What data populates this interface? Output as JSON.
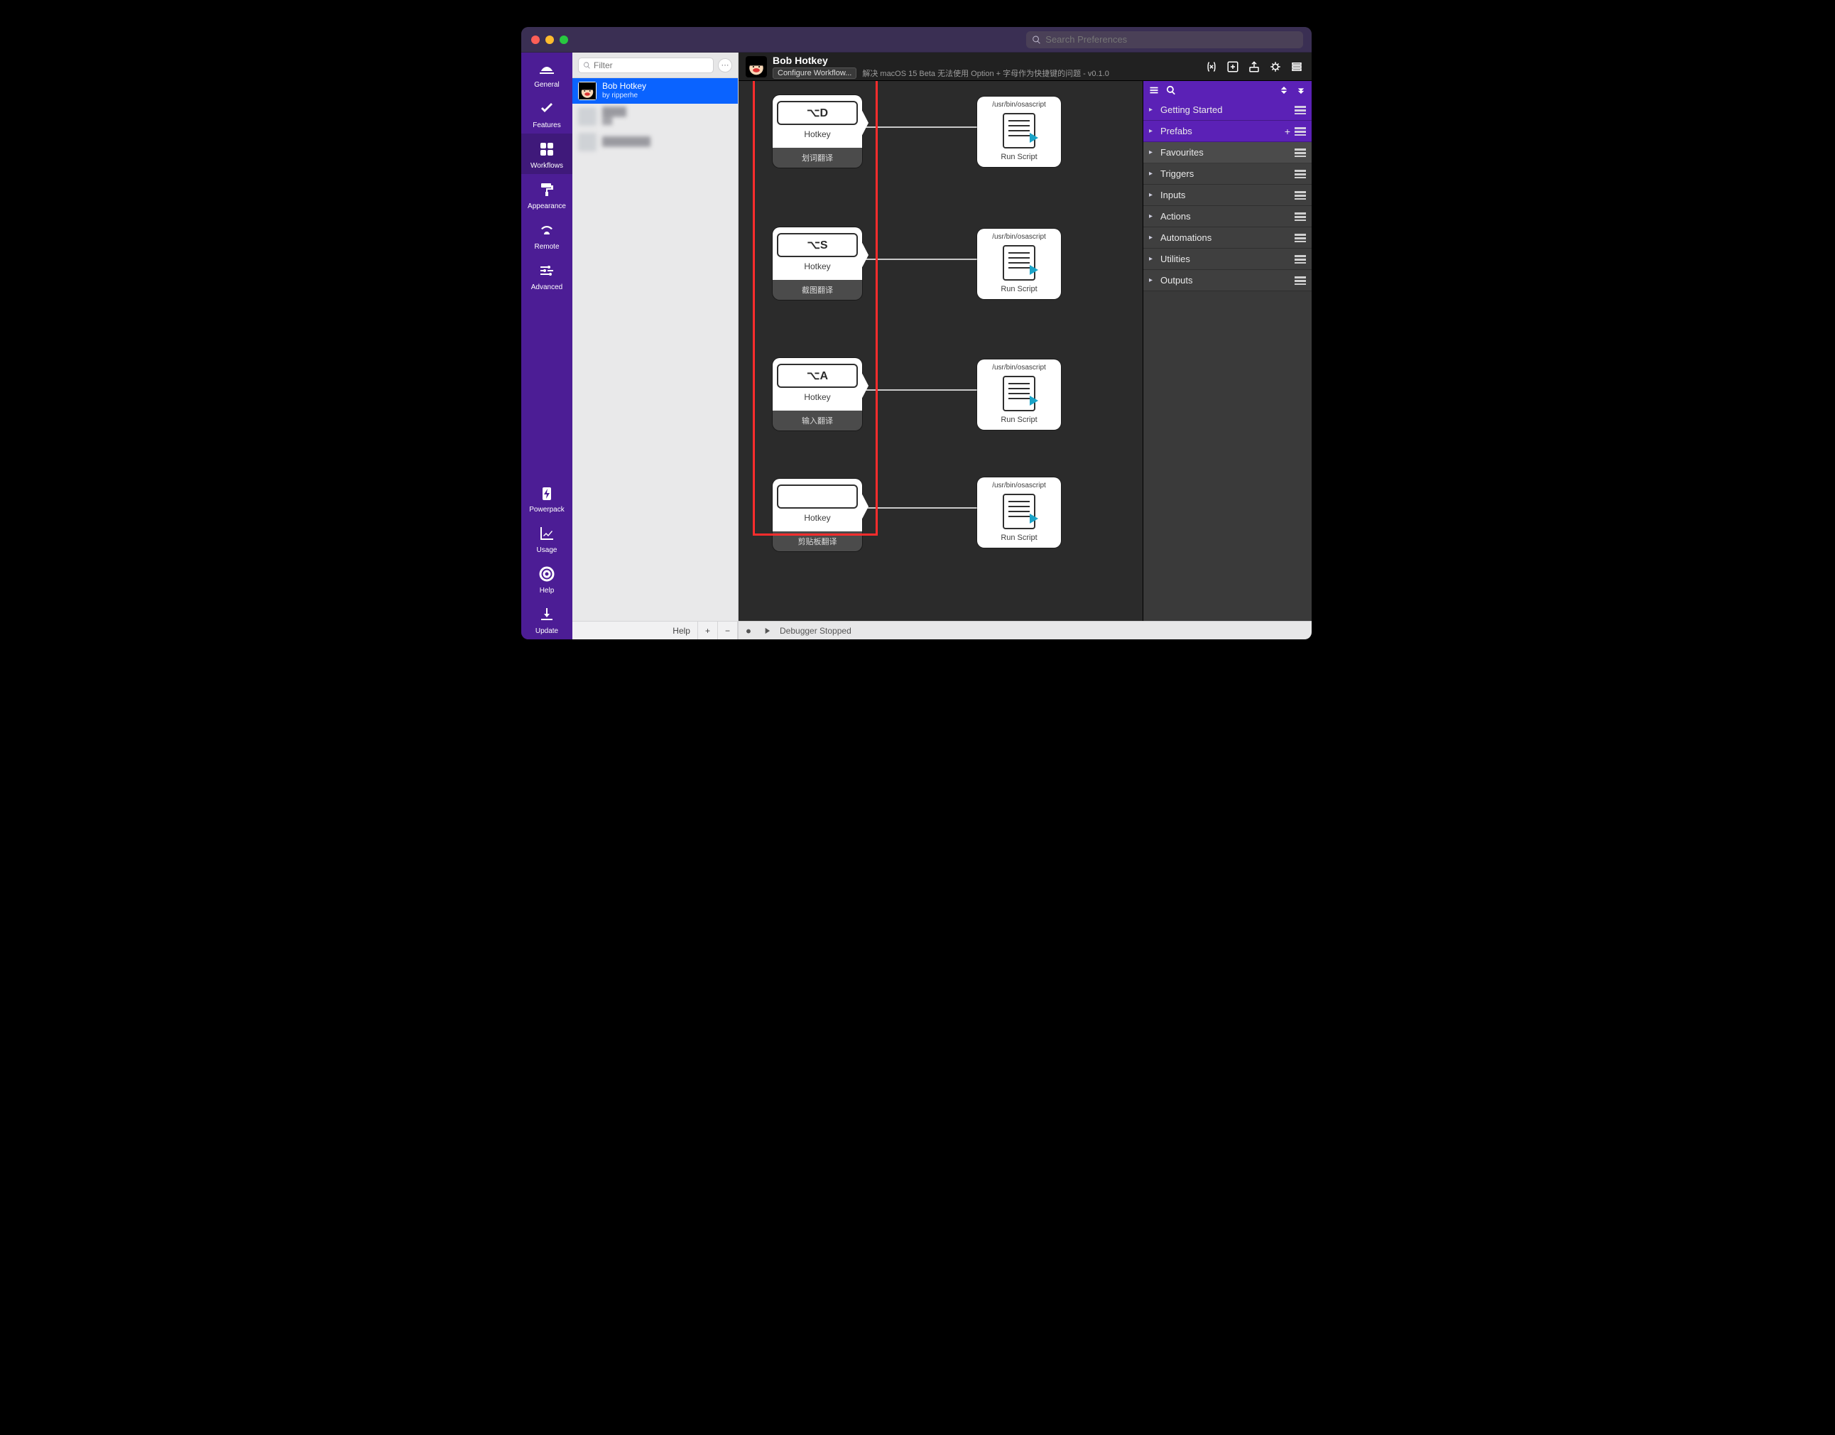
{
  "titlebar": {
    "search_placeholder": "Search Preferences"
  },
  "sidebar": {
    "general": "General",
    "features": "Features",
    "workflows": "Workflows",
    "appearance": "Appearance",
    "remote": "Remote",
    "advanced": "Advanced",
    "powerpack": "Powerpack",
    "usage": "Usage",
    "help": "Help",
    "update": "Update"
  },
  "list": {
    "filter_placeholder": "Filter",
    "items": [
      {
        "title": "Bob Hotkey",
        "subtitle": "by ripperhe"
      },
      {
        "title": "",
        "subtitle": ""
      },
      {
        "title": "",
        "subtitle": ""
      }
    ],
    "help_label": "Help",
    "plus": "+",
    "minus": "−"
  },
  "header": {
    "title": "Bob Hotkey",
    "configure": "Configure Workflow...",
    "description": "解决 macOS 15 Beta 无法使用 Option + 字母作为快捷键的问题 - v0.1.0"
  },
  "nodes": {
    "hotkey_label": "Hotkey",
    "runscript_label": "Run Script",
    "script_path": "/usr/bin/osascript",
    "items": [
      {
        "key": "⌥D",
        "caption": "划词翻译"
      },
      {
        "key": "⌥S",
        "caption": "截图翻译"
      },
      {
        "key": "⌥A",
        "caption": "输入翻译"
      },
      {
        "key": "",
        "caption": "剪贴板翻译"
      }
    ]
  },
  "palette": {
    "groups": [
      {
        "label": "Getting Started",
        "style": "purple",
        "plus": false
      },
      {
        "label": "Prefabs",
        "style": "purple",
        "plus": true
      },
      {
        "label": "Favourites",
        "style": "dark",
        "plus": false
      },
      {
        "label": "Triggers",
        "style": "darker",
        "plus": false
      },
      {
        "label": "Inputs",
        "style": "darker",
        "plus": false
      },
      {
        "label": "Actions",
        "style": "darker",
        "plus": false
      },
      {
        "label": "Automations",
        "style": "darker",
        "plus": false
      },
      {
        "label": "Utilities",
        "style": "darker",
        "plus": false
      },
      {
        "label": "Outputs",
        "style": "darker",
        "plus": false
      }
    ]
  },
  "status": {
    "debugger": "Debugger Stopped"
  }
}
